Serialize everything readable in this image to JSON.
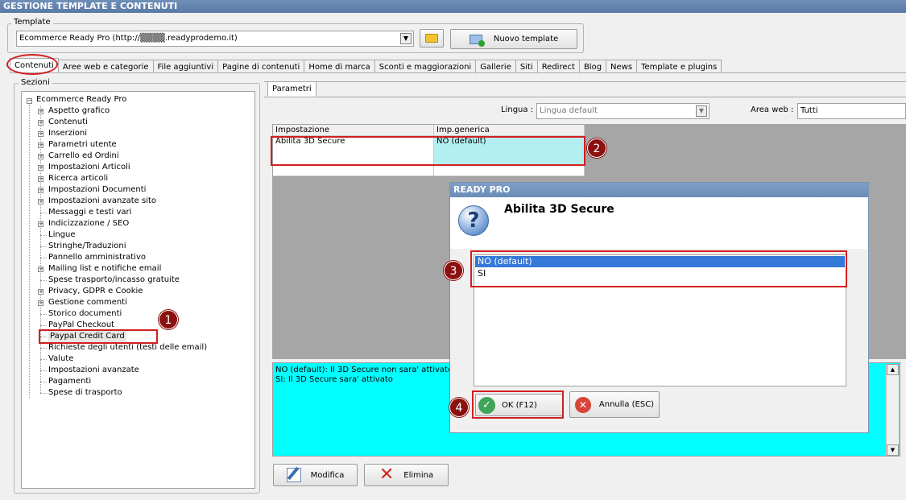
{
  "window": {
    "title": "GESTIONE TEMPLATE E CONTENUTI"
  },
  "template": {
    "group_label": "Template",
    "selected": "Ecommerce Ready Pro (http://▒▒▒▒.readyprodemo.it)",
    "new_label": "Nuovo template"
  },
  "tabs": [
    "Contenuti",
    "Aree web e categorie",
    "File aggiuntivi",
    "Pagine di contenuti",
    "Home di marca",
    "Sconti e maggiorazioni",
    "Gallerie",
    "Siti",
    "Redirect",
    "Blog",
    "News",
    "Template e plugins"
  ],
  "sections": {
    "group_label": "Sezioni",
    "root": "Ecommerce Ready Pro",
    "items": [
      {
        "label": "Aspetto grafico",
        "expandable": true
      },
      {
        "label": "Contenuti",
        "expandable": true
      },
      {
        "label": "Inserzioni",
        "expandable": true
      },
      {
        "label": "Parametri utente",
        "expandable": true
      },
      {
        "label": "Carrello ed Ordini",
        "expandable": true
      },
      {
        "label": "Impostazioni Articoli",
        "expandable": true
      },
      {
        "label": "Ricerca articoli",
        "expandable": true
      },
      {
        "label": "Impostazioni Documenti",
        "expandable": true
      },
      {
        "label": "Impostazioni avanzate sito",
        "expandable": true
      },
      {
        "label": "Messaggi e testi vari",
        "expandable": false
      },
      {
        "label": "Indicizzazione / SEO",
        "expandable": true
      },
      {
        "label": "Lingue",
        "expandable": false
      },
      {
        "label": "Stringhe/Traduzioni",
        "expandable": false
      },
      {
        "label": "Pannello amministrativo",
        "expandable": false
      },
      {
        "label": "Mailing list e notifiche email",
        "expandable": true
      },
      {
        "label": "Spese trasporto/incasso gratuite",
        "expandable": false
      },
      {
        "label": "Privacy, GDPR e Cookie",
        "expandable": true
      },
      {
        "label": "Gestione commenti",
        "expandable": true
      },
      {
        "label": "Storico documenti",
        "expandable": false
      },
      {
        "label": "PayPal Checkout",
        "expandable": false
      },
      {
        "label": "Paypal Credit Card",
        "expandable": false,
        "selected": true
      },
      {
        "label": "Richieste degli utenti (testi delle email)",
        "expandable": false
      },
      {
        "label": "Valute",
        "expandable": false
      },
      {
        "label": "Impostazioni avanzate",
        "expandable": false
      },
      {
        "label": "Pagamenti",
        "expandable": false
      },
      {
        "label": "Spese di trasporto",
        "expandable": false
      }
    ]
  },
  "params": {
    "tab": "Parametri",
    "lingua_label": "Lingua :",
    "lingua_value": "Lingua default",
    "area_label": "Area web :",
    "area_value": "Tutti",
    "col1": "Impostazione",
    "col2": "Imp.generica",
    "row_setting": "Abilita 3D Secure",
    "row_value": "NO (default)",
    "description_lines": [
      "NO (default): Il 3D Secure non sara' attivato",
      "SI: Il 3D Secure sara' attivato"
    ]
  },
  "buttons": {
    "modify": "Modifica",
    "delete": "Elimina"
  },
  "dialog": {
    "title": "READY PRO",
    "heading": "Abilita 3D Secure",
    "options": [
      "NO (default)",
      "SI"
    ],
    "selected_option": "NO (default)",
    "ok": "OK (F12)",
    "cancel": "Annulla (ESC)"
  },
  "annotations": [
    "1",
    "2",
    "3",
    "4"
  ],
  "colors": {
    "annotation_red": "#d21f1f",
    "badge": "#8b1010",
    "selection_cyan": "#b3eef0",
    "description_bg": "#00ffff",
    "list_selection": "#3478d8"
  }
}
